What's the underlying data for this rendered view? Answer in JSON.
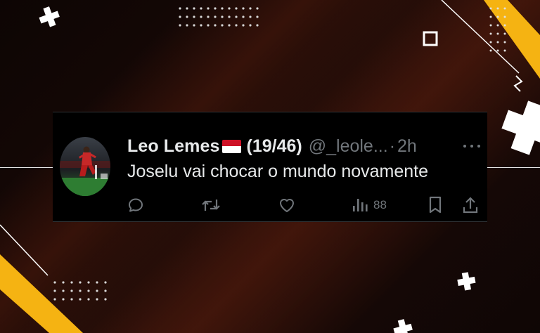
{
  "tweet": {
    "display_name": "Leo Lemes",
    "count": "(19/46)",
    "handle": "@_leole...",
    "separator": "·",
    "time": "2h",
    "text": "Joselu vai chocar o mundo novamente",
    "views": "88"
  },
  "icons": {
    "flag": "indonesia-flag",
    "reply": "reply-icon",
    "retweet": "retweet-icon",
    "like": "like-icon",
    "views": "views-icon",
    "bookmark": "bookmark-icon",
    "share": "share-icon",
    "more": "more-icon"
  },
  "colors": {
    "card_background": "#000000",
    "primary_text": "#e7e9ea",
    "secondary_text": "#71767b",
    "accent_yellow": "#f5b312"
  }
}
